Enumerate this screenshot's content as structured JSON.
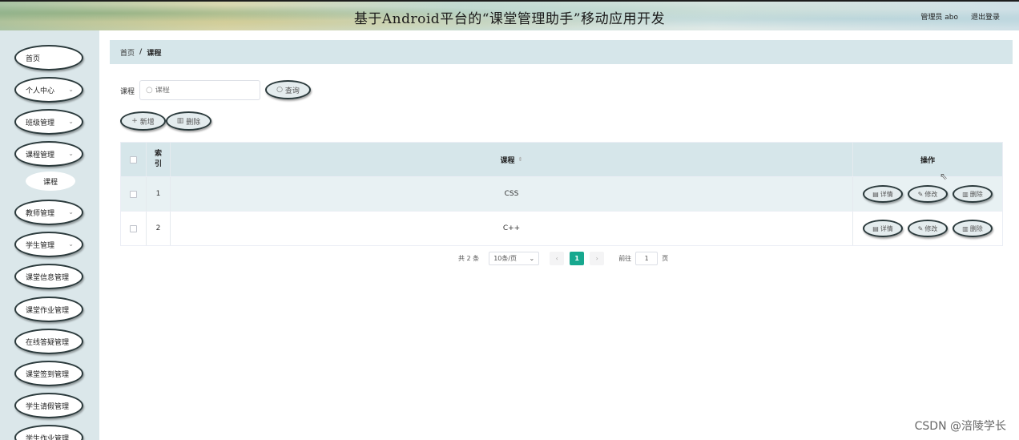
{
  "header": {
    "title": "基于Android平台的“课堂管理助手”移动应用开发",
    "user_label": "管理员 abo",
    "logout_label": "退出登录"
  },
  "sidebar": {
    "items": [
      {
        "label": "首页",
        "has_chevron": false
      },
      {
        "label": "个人中心",
        "has_chevron": true
      },
      {
        "label": "班级管理",
        "has_chevron": true
      },
      {
        "label": "课程管理",
        "has_chevron": true
      },
      {
        "label": "教师管理",
        "has_chevron": true
      },
      {
        "label": "学生管理",
        "has_chevron": true
      },
      {
        "label": "课堂信息管理",
        "has_chevron": false
      },
      {
        "label": "课堂作业管理",
        "has_chevron": false
      },
      {
        "label": "在线答疑管理",
        "has_chevron": false
      },
      {
        "label": "课堂签到管理",
        "has_chevron": false
      },
      {
        "label": "学生请假管理",
        "has_chevron": false
      },
      {
        "label": "学生作业管理",
        "has_chevron": false
      }
    ],
    "sub_item_label": "课程"
  },
  "breadcrumb": {
    "home": "首页",
    "separator": "/",
    "current": "课程"
  },
  "search": {
    "label": "课程",
    "placeholder": "课程",
    "button_label": "查询"
  },
  "toolbar": {
    "add_label": "新增",
    "delete_label": "删除"
  },
  "table": {
    "headers": {
      "index": "索引",
      "course": "课程",
      "operations": "操作"
    },
    "rows": [
      {
        "index": "1",
        "course": "CSS"
      },
      {
        "index": "2",
        "course": "C++"
      }
    ],
    "actions": {
      "detail": "详情",
      "edit": "修改",
      "delete": "删除"
    }
  },
  "pagination": {
    "total_text": "共 2 条",
    "page_size": "10条/页",
    "current_page": "1",
    "goto_prefix": "前往",
    "goto_value": "1",
    "goto_suffix": "页"
  },
  "watermark": "CSDN @涪陵学长",
  "colors": {
    "sidebar_bg": "#dbe7ea",
    "breadcrumb_bg": "#d6e6ea",
    "active_page": "#17a88f"
  }
}
